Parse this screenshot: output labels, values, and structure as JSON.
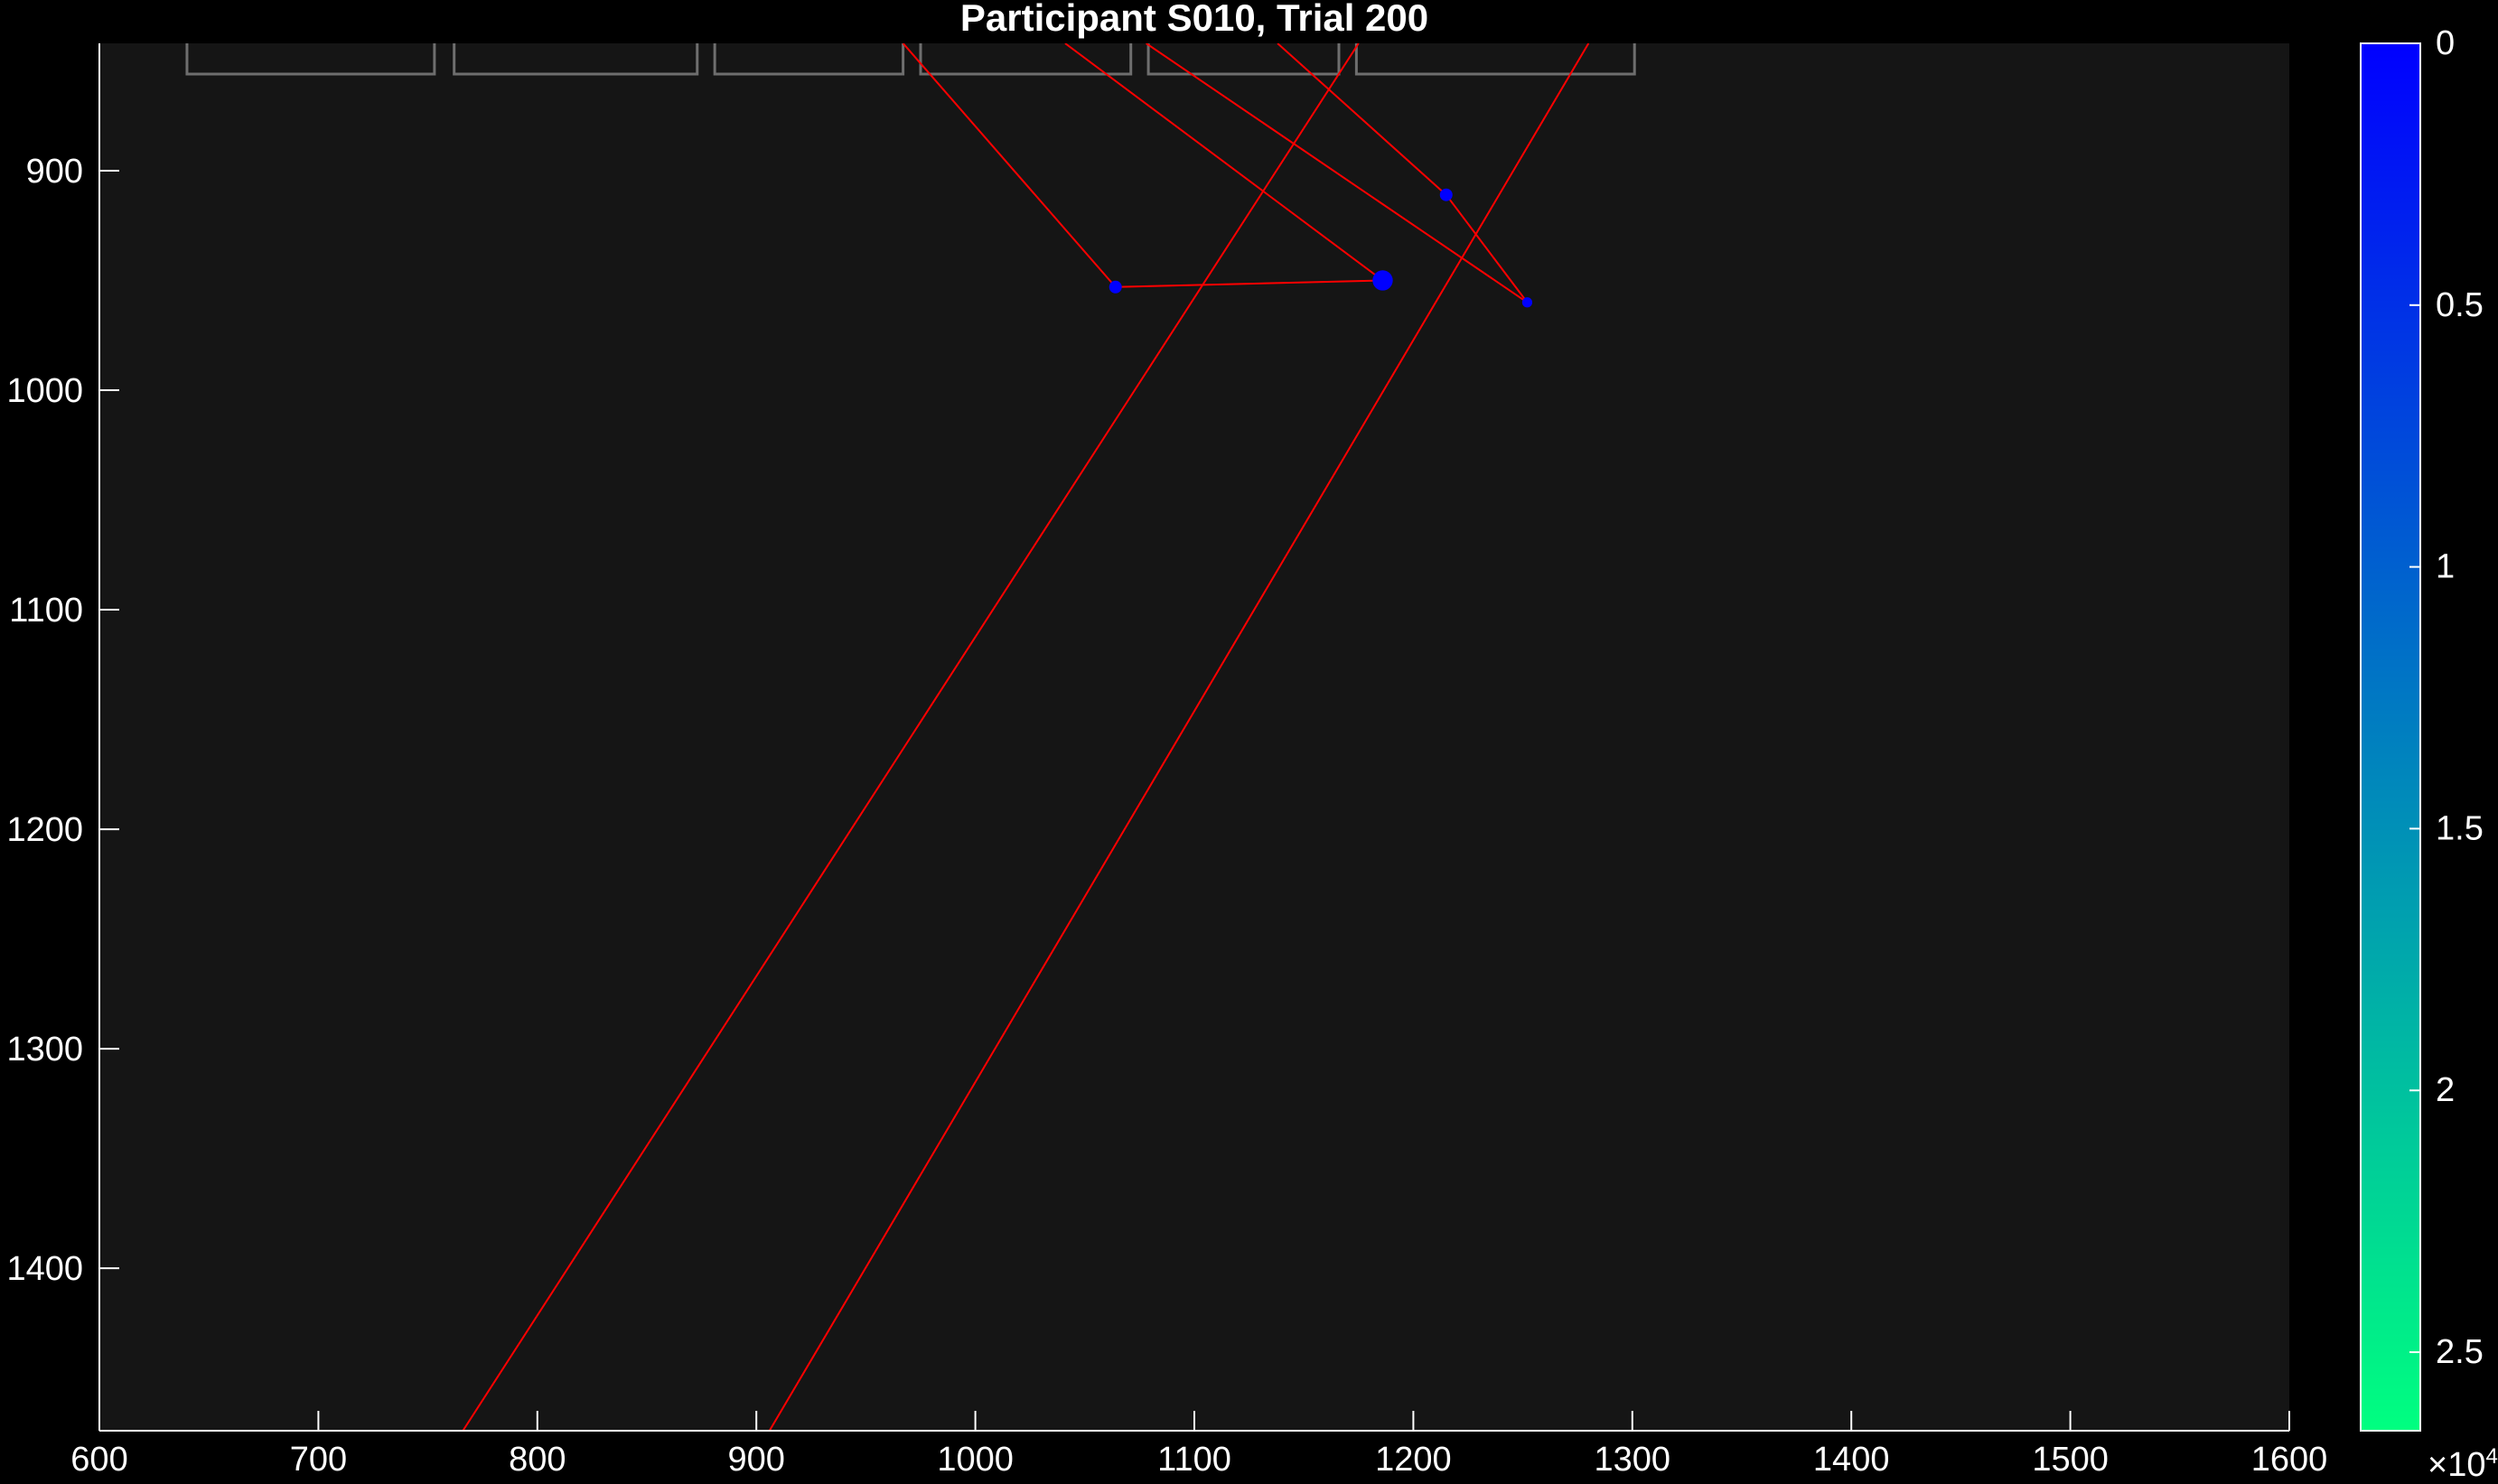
{
  "chart_data": {
    "type": "scatter",
    "title": "Participant S010, Trial 200",
    "xlabel": "",
    "ylabel": "",
    "xlim": [
      600,
      1600
    ],
    "ylim": [
      842,
      1474
    ],
    "y_reversed": true,
    "x_ticks": [
      600,
      700,
      800,
      900,
      1000,
      1100,
      1200,
      1300,
      1400,
      1500,
      1600
    ],
    "y_ticks": [
      900,
      1000,
      1100,
      1200,
      1300,
      1400
    ],
    "x_tick_labels": [
      "600",
      "700",
      "800",
      "900",
      "1000",
      "1100",
      "1200",
      "1300",
      "1400",
      "1500",
      "1600"
    ],
    "y_tick_labels": [
      "900",
      "1000",
      "1100",
      "1200",
      "1300",
      "1400"
    ],
    "grid": false,
    "colors": {
      "background": "#000000",
      "axes_background": "#151515",
      "axes": "#ffffff",
      "path": "#ff0000",
      "points": "#0000ff",
      "aoi_boxes": "#6e6e6e"
    },
    "aoi_boxes": [
      {
        "x0": 640,
        "x1": 753
      },
      {
        "x0": 762,
        "x1": 873
      },
      {
        "x0": 881,
        "x1": 967
      },
      {
        "x0": 975,
        "x1": 1071
      },
      {
        "x0": 1079,
        "x1": 1166
      },
      {
        "x0": 1174,
        "x1": 1301
      }
    ],
    "aoi_box_bottom": 856,
    "path_segments": [
      {
        "x": [
          967,
          1064
        ],
        "y": [
          842,
          953
        ]
      },
      {
        "x": [
          1064,
          1186
        ],
        "y": [
          953,
          950
        ]
      },
      {
        "x": [
          1186,
          1041
        ],
        "y": [
          950,
          842
        ]
      },
      {
        "x": [
          1078,
          1252
        ],
        "y": [
          842,
          960
        ]
      },
      {
        "x": [
          1252,
          1215
        ],
        "y": [
          960,
          911
        ]
      },
      {
        "x": [
          1215,
          1138
        ],
        "y": [
          911,
          842
        ]
      },
      {
        "x": [
          1175,
          766
        ],
        "y": [
          842,
          1474
        ]
      },
      {
        "x": [
          1280,
          906
        ],
        "y": [
          842,
          1474
        ]
      }
    ],
    "points": [
      {
        "x": 1064,
        "y": 953,
        "size": 1.0
      },
      {
        "x": 1186,
        "y": 950,
        "size": 1.6
      },
      {
        "x": 1215,
        "y": 911,
        "size": 1.0
      },
      {
        "x": 1252,
        "y": 960,
        "size": 0.8
      }
    ],
    "colorbar": {
      "colormap": "winter",
      "range": [
        0,
        2.65
      ],
      "reversed": true,
      "ticks": [
        0,
        0.5,
        1,
        1.5,
        2,
        2.5
      ],
      "tick_labels": [
        "0",
        "0.5",
        "1",
        "1.5",
        "2",
        "2.5"
      ],
      "multiplier": "×10",
      "multiplier_exponent": "4",
      "color_top": "#0000ff",
      "color_bottom": "#00ff80"
    }
  }
}
